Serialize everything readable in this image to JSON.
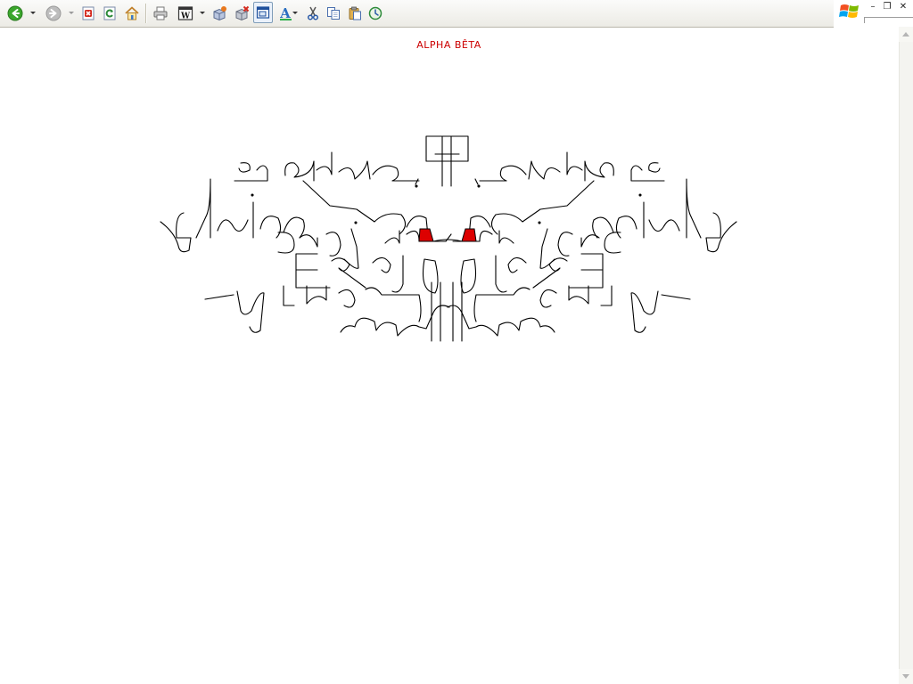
{
  "toolbar": {
    "buttons": [
      {
        "name": "back-button",
        "icon": "back-arrow-icon",
        "color": "#3a9a2a"
      },
      {
        "name": "forward-button",
        "icon": "forward-arrow-icon",
        "color": "#9a9a9a"
      },
      {
        "name": "stop-button",
        "icon": "stop-icon",
        "color": "#d42a1e"
      },
      {
        "name": "refresh-button",
        "icon": "refresh-icon",
        "color": "#2d8a3a"
      },
      {
        "name": "home-button",
        "icon": "home-icon",
        "color": "#e0a030"
      },
      {
        "name": "print-button",
        "icon": "printer-icon"
      },
      {
        "name": "word-button",
        "icon": "word-document-icon"
      },
      {
        "name": "add-component-button",
        "icon": "add-package-icon"
      },
      {
        "name": "remove-component-button",
        "icon": "remove-package-icon"
      },
      {
        "name": "open-window-button",
        "icon": "window-icon"
      },
      {
        "name": "font-button",
        "icon": "font-a-icon"
      },
      {
        "name": "cut-button",
        "icon": "scissors-icon"
      },
      {
        "name": "copy-button",
        "icon": "copy-icon"
      },
      {
        "name": "paste-button",
        "icon": "paste-icon"
      },
      {
        "name": "history-button",
        "icon": "history-clock-icon"
      }
    ]
  },
  "window": {
    "minimize_glyph": "–",
    "restore_glyph": "❐",
    "close_glyph": "✕"
  },
  "page": {
    "title": "ALPHA BÊTA"
  },
  "colors": {
    "title": "#cc0000",
    "ink": "#000000",
    "accent": "#dd0000"
  }
}
